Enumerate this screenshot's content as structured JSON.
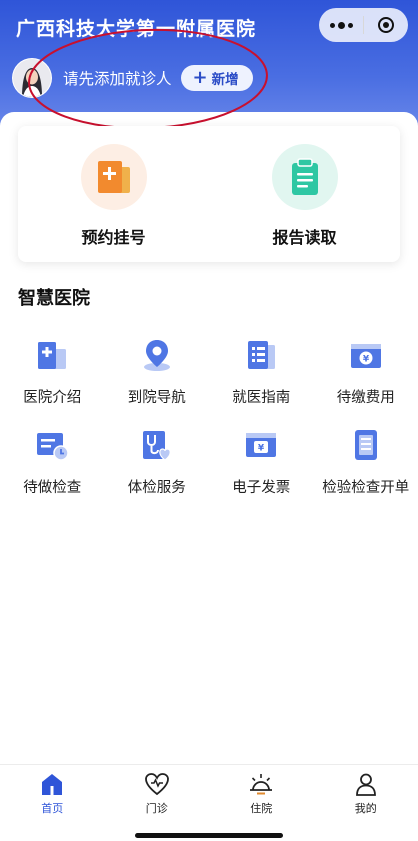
{
  "app": {
    "title": "广西科技大学第一附属医院"
  },
  "patient": {
    "prompt": "请先添加就诊人",
    "add_label": "新增"
  },
  "quick_actions": [
    {
      "label": "预约挂号",
      "icon": "appointment-icon",
      "color": "#f5a23a"
    },
    {
      "label": "报告读取",
      "icon": "report-clipboard-icon",
      "color": "#2ec7a3"
    }
  ],
  "section": {
    "title": "智慧医院"
  },
  "services": [
    {
      "label": "医院介绍",
      "icon": "hospital-building-icon"
    },
    {
      "label": "到院导航",
      "icon": "location-pin-icon"
    },
    {
      "label": "就医指南",
      "icon": "guide-list-icon"
    },
    {
      "label": "待缴费用",
      "icon": "pending-payment-icon"
    },
    {
      "label": "待做检查",
      "icon": "pending-exam-icon"
    },
    {
      "label": "体检服务",
      "icon": "stethoscope-icon"
    },
    {
      "label": "电子发票",
      "icon": "e-invoice-icon"
    },
    {
      "label": "检验检查开单",
      "icon": "lab-order-icon"
    }
  ],
  "tabs": [
    {
      "label": "首页",
      "icon": "home-icon",
      "active": true
    },
    {
      "label": "门诊",
      "icon": "heart-icon",
      "active": false
    },
    {
      "label": "住院",
      "icon": "sunrise-icon",
      "active": false
    },
    {
      "label": "我的",
      "icon": "person-icon",
      "active": false
    }
  ],
  "colors": {
    "brand": "#2f55d8",
    "icon_blue": "#4f76e4",
    "annotation": "#c8102e"
  }
}
